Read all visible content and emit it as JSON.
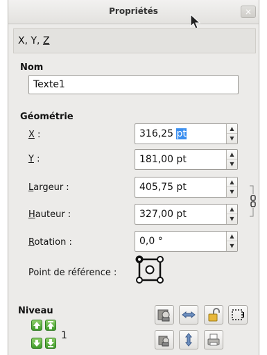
{
  "window": {
    "title": "Propriétés",
    "close_glyph": "×"
  },
  "tab": {
    "label_prefix": "X, Y, ",
    "label_accel": "Z"
  },
  "name_section": {
    "heading": "Nom",
    "value": "Texte1"
  },
  "geometry": {
    "heading": "Géométrie",
    "x": {
      "accel": "X",
      "rest": " :",
      "value_plain": "316,25 ",
      "value_selected": "pt"
    },
    "y": {
      "accel": "Y",
      "rest": " :",
      "value": "181,00 pt"
    },
    "width": {
      "accel": "L",
      "rest": "argeur :",
      "value": "405,75 pt"
    },
    "height": {
      "accel": "H",
      "rest": "auteur :",
      "value": "327,00 pt"
    },
    "rotation": {
      "accel": "R",
      "rest": "otation :",
      "value": "0,0 °"
    },
    "reference_point": {
      "label": "Point de référence :"
    }
  },
  "level": {
    "heading": "Niveau",
    "value": "1"
  },
  "icons": {
    "spin_up": "▲",
    "spin_down": "▼",
    "chain": "chain-link-icon",
    "cursor": "mouse-pointer-icon"
  },
  "colors": {
    "selection": "#3b8ff0",
    "level_green": "#3f9a2a",
    "window_bg": "#ecebe9"
  }
}
